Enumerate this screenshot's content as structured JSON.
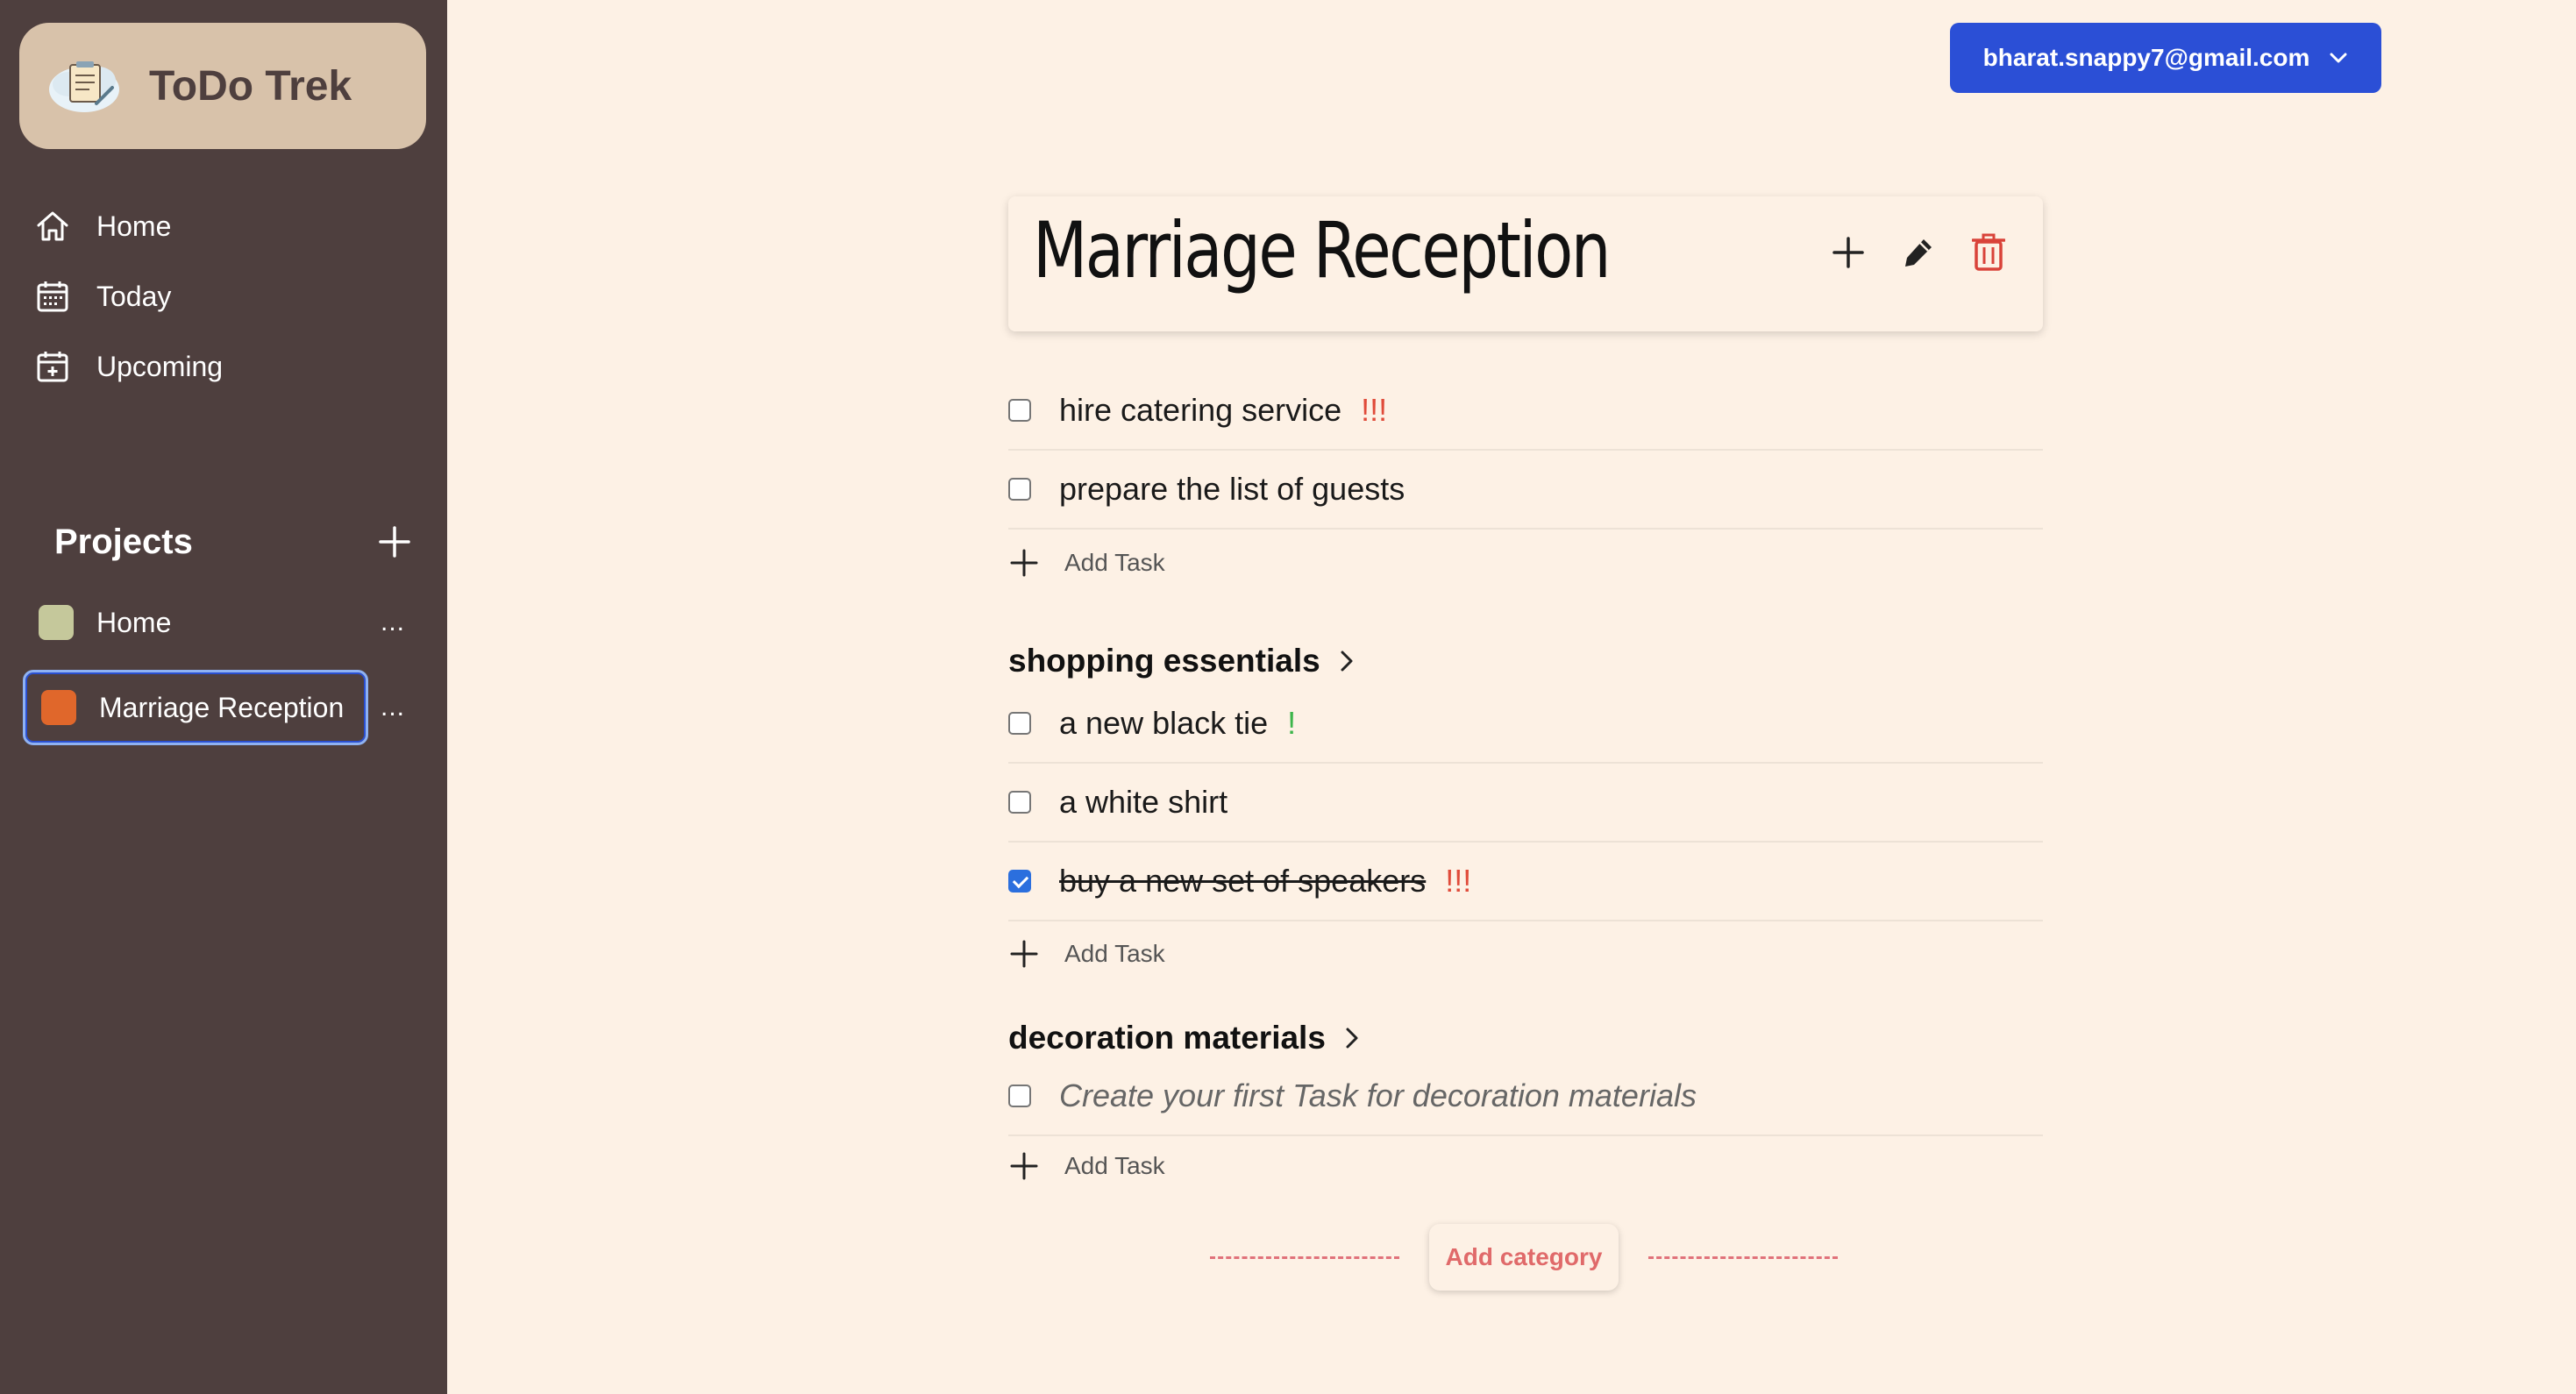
{
  "app": {
    "title": "ToDo Trek"
  },
  "nav": [
    {
      "label": "Home",
      "icon": "home-icon"
    },
    {
      "label": "Today",
      "icon": "calendar-icon"
    },
    {
      "label": "Upcoming",
      "icon": "calendar-plus-icon"
    }
  ],
  "projects": {
    "title": "Projects",
    "items": [
      {
        "label": "Home",
        "color": "#c5c89b",
        "more": "...",
        "active": false
      },
      {
        "label": "Marriage Reception",
        "color": "#e0672b",
        "more": "...",
        "active": true
      }
    ]
  },
  "account": {
    "email": "bharat.snappy7@gmail.com"
  },
  "project": {
    "name": "Marriage Reception",
    "tasks": [
      {
        "text": "hire catering service",
        "priority": "!!!",
        "priority_color": "#e04b3a",
        "checked": false
      },
      {
        "text": "prepare the list of guests",
        "priority": "",
        "checked": false
      }
    ],
    "add_task_label": "Add Task",
    "categories": [
      {
        "name": "shopping essentials",
        "tasks": [
          {
            "text": "a new black tie",
            "priority": "!",
            "priority_color": "#3cb54a",
            "checked": false
          },
          {
            "text": "a white shirt",
            "priority": "",
            "checked": false
          },
          {
            "text": "buy a new set of speakers",
            "priority": "!!!",
            "priority_color": "#e04b3a",
            "checked": true
          }
        ],
        "add_task_label": "Add Task"
      },
      {
        "name": "decoration materials",
        "tasks": [
          {
            "text": "Create your first Task for decoration materials",
            "placeholder": true,
            "checked": false
          }
        ],
        "add_task_label": "Add Task"
      }
    ],
    "add_category_label": "Add category"
  },
  "colors": {
    "sidebar": "#4e3f3e",
    "background": "#fdf1e5",
    "accent": "#2b4fd6",
    "danger": "#d9433a"
  }
}
